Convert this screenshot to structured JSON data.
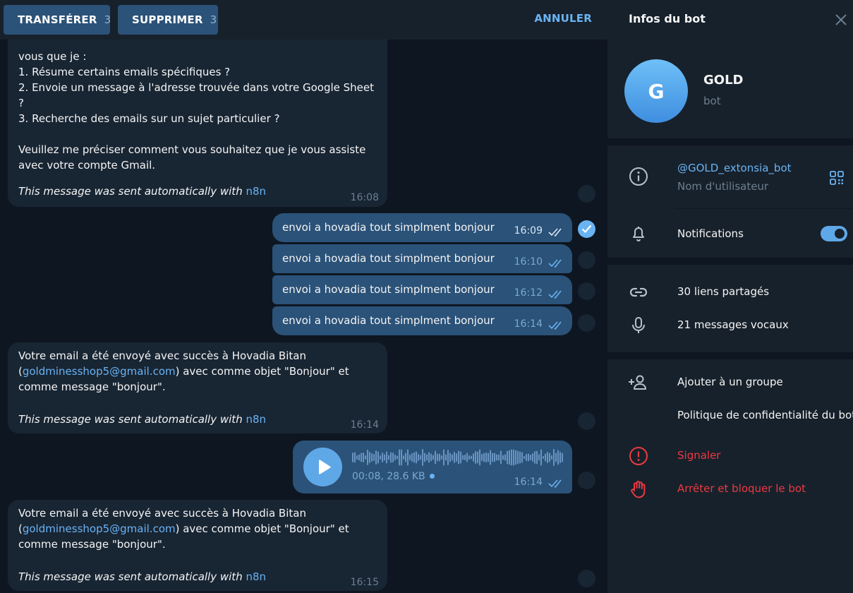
{
  "topbar": {
    "forward_label": "TRANSFÉRER",
    "forward_count": "3",
    "delete_label": "SUPPRIMER",
    "delete_count": "3",
    "cancel_label": "ANNULER"
  },
  "messages": {
    "m1": {
      "lines": [
        "vous que je :",
        "1. Résume certains emails spécifiques ?",
        "2. Envoie un message à l'adresse trouvée dans votre Google Sheet",
        "?",
        "3. Recherche des emails sur un sujet particulier ?",
        "",
        "Veuillez me préciser comment vous souhaitez que je vous assiste",
        "avec votre compte Gmail."
      ],
      "auto_prefix": "This message was sent automatically with ",
      "auto_link": "n8n",
      "time": "16:08"
    },
    "out": [
      {
        "text": "envoi a hovadia tout simplment bonjour",
        "time": "16:09",
        "selected": true
      },
      {
        "text": "envoi a hovadia tout simplment bonjour",
        "time": "16:10",
        "selected": false
      },
      {
        "text": "envoi a hovadia tout simplment bonjour",
        "time": "16:12",
        "selected": false
      },
      {
        "text": "envoi a hovadia tout simplment bonjour",
        "time": "16:14",
        "selected": false
      }
    ],
    "m2": {
      "line1": "Votre email a été envoyé avec succès à Hovadia Bitan",
      "line2_pre": "(",
      "email": "goldminesshop5@gmail.com",
      "line2_post": ") avec comme objet \"Bonjour\" et",
      "line3": "comme message \"bonjour\".",
      "auto_prefix": "This message was sent automatically with ",
      "auto_link": "n8n",
      "time": "16:14"
    },
    "voice": {
      "meta": "00:08, 28.6 KB",
      "time": "16:14"
    },
    "m3": {
      "line1": "Votre email a été envoyé avec succès à Hovadia Bitan",
      "line2_pre": "(",
      "email": "goldminesshop5@gmail.com",
      "line2_post": ") avec comme objet \"Bonjour\" et",
      "line3": "comme message \"bonjour\".",
      "auto_prefix": "This message was sent automatically with ",
      "auto_link": "n8n",
      "time": "16:15"
    }
  },
  "panel": {
    "title": "Infos du bot",
    "avatar_letter": "G",
    "name": "GOLD",
    "subtitle": "bot",
    "username": "@GOLD_extonsia_bot",
    "username_label": "Nom d'utilisateur",
    "notifications_label": "Notifications",
    "notifications_on": true,
    "shared_links": "30 liens partagés",
    "voice_messages": "21 messages vocaux",
    "add_to_group": "Ajouter à un groupe",
    "privacy_policy": "Politique de confidentialité du bot",
    "report": "Signaler",
    "block": "Arrêter et bloquer le bot"
  },
  "colors": {
    "accent": "#6ab3f3",
    "outgoing_bubble": "#2b5278",
    "incoming_bubble": "#182533",
    "danger": "#ec3942"
  }
}
